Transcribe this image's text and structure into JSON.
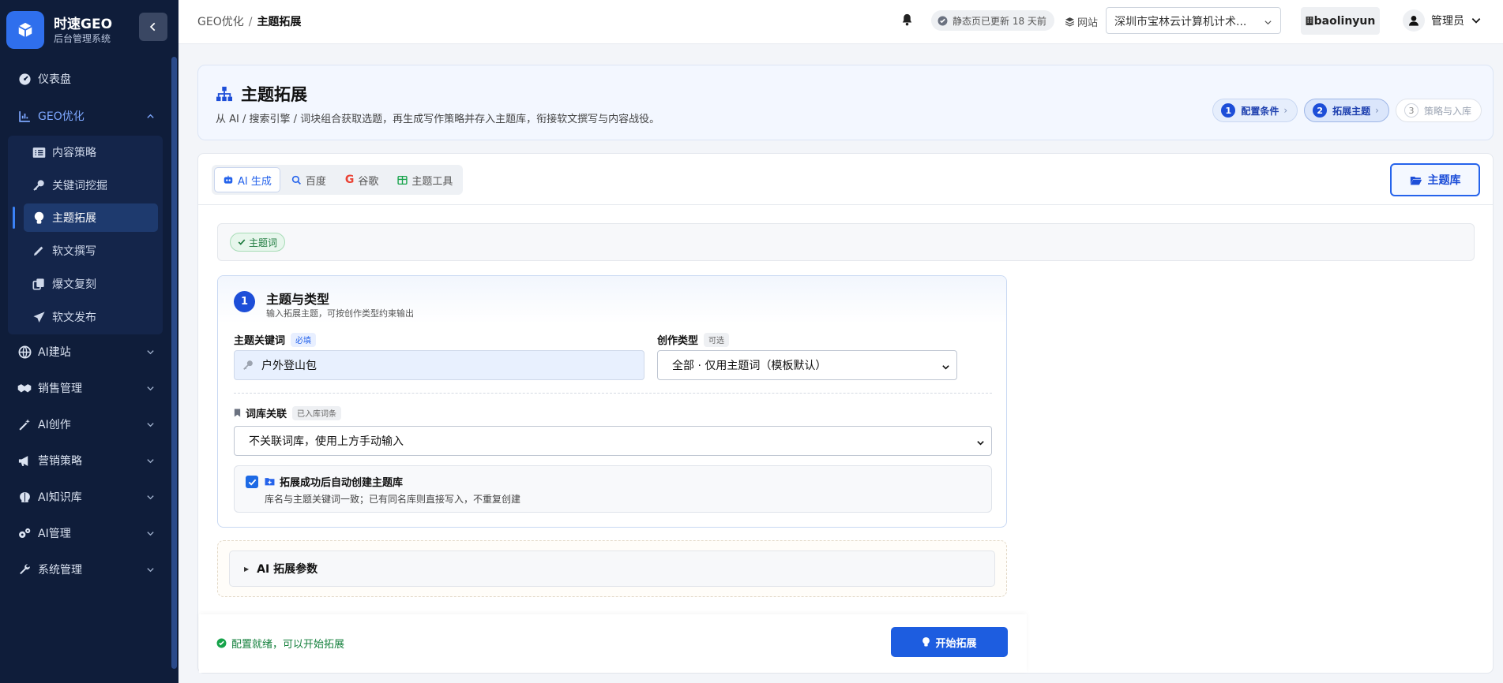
{
  "brand": {
    "title": "时速GEO",
    "subtitle": "后台管理系统"
  },
  "sidebar": {
    "items": [
      {
        "label": "仪表盘",
        "icon": "dashboard-icon"
      },
      {
        "label": "GEO优化",
        "icon": "chart-icon",
        "expanded": true
      },
      {
        "label": "AI建站",
        "icon": "globe-icon"
      },
      {
        "label": "销售管理",
        "icon": "handshake-icon"
      },
      {
        "label": "AI创作",
        "icon": "magic-wand-icon"
      },
      {
        "label": "营销策略",
        "icon": "megaphone-icon"
      },
      {
        "label": "AI知识库",
        "icon": "brain-icon"
      },
      {
        "label": "AI管理",
        "icon": "gears-icon"
      },
      {
        "label": "系统管理",
        "icon": "wrench-icon"
      }
    ],
    "sub_items": [
      {
        "label": "内容策略",
        "icon": "list-icon"
      },
      {
        "label": "关键词挖掘",
        "icon": "key-icon"
      },
      {
        "label": "主题拓展",
        "icon": "lightbulb-icon",
        "active": true
      },
      {
        "label": "软文撰写",
        "icon": "pen-icon"
      },
      {
        "label": "爆文复刻",
        "icon": "copy-icon"
      },
      {
        "label": "软文发布",
        "icon": "send-icon"
      }
    ]
  },
  "topbar": {
    "breadcrumb_parent": "GEO优化",
    "breadcrumb_sep": "/",
    "breadcrumb_current": "主题拓展",
    "static_status": "静态页已更新 18 天前",
    "site_label": "网站",
    "site_value": "深圳市宝林云计算机计术...",
    "username": "baolinyun",
    "role": "管理员"
  },
  "hero": {
    "title": "主题拓展",
    "description": "从 AI / 搜索引擎 / 词块组合获取选题，再生成写作策略并存入主题库，衔接软文撰写与内容战役。",
    "steps": [
      {
        "num": "1",
        "label": "配置条件",
        "state": "done"
      },
      {
        "num": "2",
        "label": "拓展主题",
        "state": "current"
      },
      {
        "num": "3",
        "label": "策略与入库",
        "state": "pending"
      }
    ]
  },
  "tabs": [
    {
      "label": "AI 生成",
      "icon": "robot-icon",
      "active": true
    },
    {
      "label": "百度",
      "icon": "search-icon"
    },
    {
      "label": "谷歌",
      "icon": "google-icon"
    },
    {
      "label": "主题工具",
      "icon": "table-icon"
    }
  ],
  "library_button": "主题库",
  "keyword_tag": "主题词",
  "section": {
    "number": "1",
    "title": "主题与类型",
    "subtitle": "输入拓展主题，可按创作类型约束输出",
    "keyword_label": "主题关键词",
    "keyword_required": "必填",
    "keyword_value": "户外登山包",
    "type_label": "创作类型",
    "type_optional": "可选",
    "type_value": "全部 · 仅用主题词（模板默认）",
    "lexicon_label": "词库关联",
    "lexicon_tag": "已入库词条",
    "lexicon_value": "不关联词库，使用上方手动输入",
    "auto_create_title": "拓展成功后自动创建主题库",
    "auto_create_desc": "库名与主题关键词一致；已有同名库则直接写入，不重复创建",
    "auto_create_checked": true
  },
  "advanced": {
    "label": "AI 拓展参数"
  },
  "footer": {
    "status": "配置就绪，可以开始拓展",
    "start_button": "开始拓展"
  },
  "colors": {
    "primary": "#1d5de0",
    "sidebar_bg": "#0f1d3a",
    "success": "#15803d"
  }
}
